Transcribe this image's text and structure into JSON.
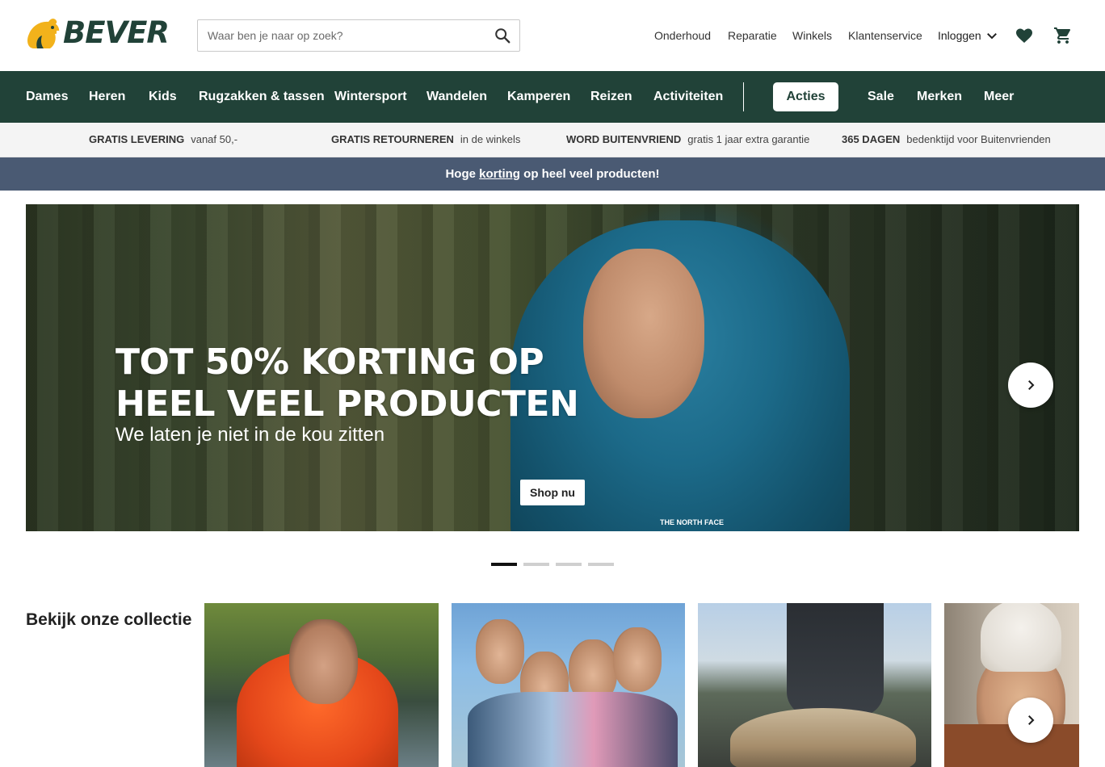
{
  "brand": {
    "logo_text": "BEVER",
    "colors": {
      "primary": "#214238",
      "accent": "#f2b21b",
      "promo_bar": "#4a5a73"
    }
  },
  "search": {
    "placeholder": "Waar ben je naar op zoek?",
    "icon": "search-icon"
  },
  "topnav": {
    "links": [
      "Onderhoud",
      "Reparatie",
      "Winkels",
      "Klantenservice"
    ],
    "login_label": "Inloggen",
    "icons": [
      "chevron-down-icon",
      "heart-icon",
      "cart-icon"
    ]
  },
  "mainnav": {
    "items": [
      "Dames",
      "Heren",
      "Kids",
      "Rugzakken & tassen",
      "Wintersport",
      "Wandelen",
      "Kamperen",
      "Reizen",
      "Activiteiten"
    ],
    "highlight": "Acties",
    "secondary": [
      "Sale",
      "Merken",
      "Meer"
    ]
  },
  "usp": [
    {
      "bold": "GRATIS LEVERING",
      "text": "vanaf 50,-"
    },
    {
      "bold": "GRATIS RETOURNEREN",
      "text": "in de winkels"
    },
    {
      "bold": "WORD BUITENVRIEND",
      "text": "gratis 1 jaar extra garantie"
    },
    {
      "bold": "365 DAGEN",
      "text": "bedenktijd voor Buitenvrienden"
    }
  ],
  "promo": {
    "before": "Hoge ",
    "link": "korting",
    "after": " op heel veel producten!"
  },
  "hero": {
    "headline_1": "TOT 50% KORTING OP",
    "headline_2": "HEEL VEEL PRODUCTEN",
    "subline": "We laten je niet in de kou zitten",
    "cta": "Shop nu",
    "brand_mark": "THE NORTH FACE",
    "slides_total": 4,
    "slide_active": 1
  },
  "collection": {
    "title": "Bekijk onze collectie"
  }
}
